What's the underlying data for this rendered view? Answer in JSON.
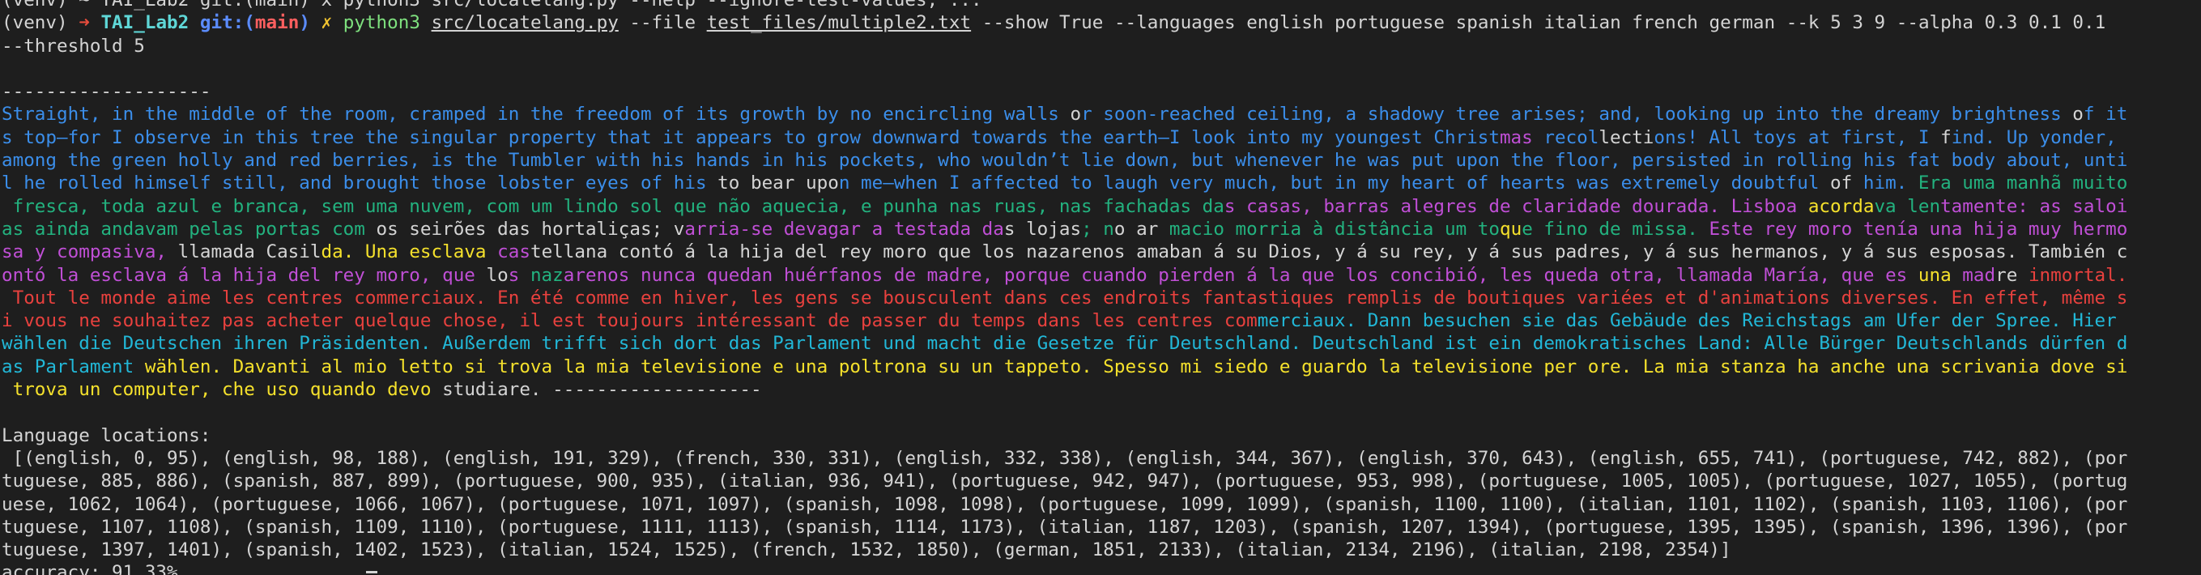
{
  "terminal": {
    "top_partial": "(venv) ~ TAI_Lab2 git:(main) x python3 src/locatelang.py --help --ignore-test-values; ...",
    "prompt": {
      "venv": "(venv) ",
      "arrow": "➜",
      "dir": "TAI_Lab2",
      "git_label": "git:(",
      "branch": "main",
      "git_close": ")",
      "mark": "✗",
      "cmd_program": "python3 ",
      "cmd_script": "src/locatelang.py",
      "cmd_file_flag": " --file ",
      "cmd_file": "test_files/multiple2.txt",
      "cmd_rest": " --show True --languages english portuguese spanish italian french german --k 5 3 9 --alpha 0.3 0.1 0.1",
      "cmd_line2": "--threshold 5"
    },
    "separator": "-------------------",
    "colored_lines": [
      [
        [
          "english",
          "Straight, in the middle of the room, cramped in the freedom of its growth by no encircling walls "
        ],
        [
          "plain",
          "o"
        ],
        [
          "english",
          "r soon-reached ceiling, a shadowy tree arises; and, looking up into the dreamy brightness "
        ],
        [
          "plain",
          "o"
        ],
        [
          "english",
          "f it"
        ]
      ],
      [
        [
          "english",
          "s top—for I observe in this tree the singular property that it appears to grow downward towards the earth—I look into my youngest Christ"
        ],
        [
          "spanish",
          "mas"
        ],
        [
          "english",
          " recol"
        ],
        [
          "plain",
          "lecti"
        ],
        [
          "english",
          "ons! All toys at first, I "
        ],
        [
          "plain",
          "f"
        ],
        [
          "english",
          "ind. Up yonder,"
        ]
      ],
      [
        [
          "english",
          "among the green holly and red berries, is the Tumbler with his hands in his pockets, who wouldn’t lie down, but whenever he was put upon the floor, persisted in rolling his fat body about, unti"
        ]
      ],
      [
        [
          "english",
          "l he rolled himself still, and brought those lobster eyes of his "
        ],
        [
          "plain",
          "to bear upo"
        ],
        [
          "english",
          "n me—when I affected to laugh very much, but in my heart of hearts was extremely doubtful "
        ],
        [
          "plain",
          "of"
        ],
        [
          "english",
          " him. "
        ],
        [
          "portuguese",
          "Era uma manhã muito"
        ]
      ],
      [
        [
          "portuguese",
          " fresca, toda azul e branca, sem uma nuvem, com um lindo sol que não aquecia, e punha nas ruas, nas fachadas da"
        ],
        [
          "spanish",
          "s casas, barras alegres de claridade dourada. Lisboa "
        ],
        [
          "italian",
          "acorda"
        ],
        [
          "portuguese",
          "va len"
        ],
        [
          "spanish",
          "tamente: as saloi"
        ]
      ],
      [
        [
          "portuguese",
          "as ainda andavam pelas portas com "
        ],
        [
          "plain",
          "os seirões das hortaliças; v"
        ],
        [
          "spanish",
          "arria-se devagar a testada da"
        ],
        [
          "plain",
          "s lojas"
        ],
        [
          "portuguese",
          "; n"
        ],
        [
          "plain",
          "o ar "
        ],
        [
          "portuguese",
          "macio morria à distância um to"
        ],
        [
          "italian",
          "qu"
        ],
        [
          "portuguese",
          "e fino de missa. "
        ],
        [
          "spanish",
          "Este rey moro tenía una hija muy hermo"
        ]
      ],
      [
        [
          "spanish",
          "sa y compasiva, "
        ],
        [
          "plain",
          "llamada Casil"
        ],
        [
          "italian",
          "da. Una esclava "
        ],
        [
          "spanish",
          "cas"
        ],
        [
          "plain",
          "tellana contó á la hija del rey moro que los nazarenos amaban á su Dios, y á su rey, y á sus padres, y á sus hermanos, y á sus esposas. También c"
        ]
      ],
      [
        [
          "spanish",
          "ontó la esclava á la hija del rey moro, que "
        ],
        [
          "plain",
          "lo"
        ],
        [
          "spanish",
          "s "
        ],
        [
          "portuguese",
          "naz"
        ],
        [
          "spanish",
          "arenos nunca quedan huérfanos de madre, porque cuando pierden á la que los concibió, les queda otra, llamada María, que es "
        ],
        [
          "italian",
          "una"
        ],
        [
          "spanish",
          " mad"
        ],
        [
          "plain",
          "re "
        ],
        [
          "french",
          "inmortal."
        ]
      ],
      [
        [
          "french",
          " Tout le monde aime les centres commerciaux. En été comme en hiver, les gens se bousculent dans ces endroits fantastiques remplis de boutiques variées et d'animations diverses. En effet, même s"
        ]
      ],
      [
        [
          "french",
          "i vous ne souhaitez pas acheter quelque chose, il est toujours intéressant de passer du temps dans les centres com"
        ],
        [
          "german",
          "merciaux. Dann besuchen sie das Gebäude des Reichstags am Ufer der Spree. Hier"
        ]
      ],
      [
        [
          "german",
          "wählen die Deutschen ihren Präsidenten. Außerdem trifft sich dort das Parlament und macht die Gesetze für Deutschland. Deutschland ist ein demokratisches Land: Alle Bürger Deutschlands dürfen d"
        ]
      ],
      [
        [
          "german",
          "as Parlament "
        ],
        [
          "italian",
          "wählen. Davanti al mio letto si trova la mia televisione e una poltrona su un tappeto. Spesso mi siedo e guardo la televisione per ore. La mia stanza ha anche una scrivania dove si"
        ]
      ],
      [
        [
          "italian",
          " trova un computer, che uso quando devo "
        ],
        [
          "plain",
          "studiare. -------------------"
        ]
      ]
    ],
    "locations_label": "Language locations:",
    "locations_lines": [
      " [(english, 0, 95), (english, 98, 188), (english, 191, 329), (french, 330, 331), (english, 332, 338), (english, 344, 367), (english, 370, 643), (english, 655, 741), (portuguese, 742, 882), (por",
      "tuguese, 885, 886), (spanish, 887, 899), (portuguese, 900, 935), (italian, 936, 941), (portuguese, 942, 947), (portuguese, 953, 998), (portuguese, 1005, 1005), (portuguese, 1027, 1055), (portug",
      "uese, 1062, 1064), (portuguese, 1066, 1067), (portuguese, 1071, 1097), (spanish, 1098, 1098), (portuguese, 1099, 1099), (spanish, 1100, 1100), (italian, 1101, 1102), (spanish, 1103, 1106), (por",
      "tuguese, 1107, 1108), (spanish, 1109, 1110), (portuguese, 1111, 1113), (spanish, 1114, 1173), (italian, 1187, 1203), (spanish, 1207, 1394), (portuguese, 1395, 1395), (spanish, 1396, 1396), (por",
      "tuguese, 1397, 1401), (spanish, 1402, 1523), (italian, 1524, 1525), (french, 1532, 1850), (german, 1851, 2133), (italian, 2134, 2196), (italian, 2198, 2354)]"
    ],
    "accuracy": "accuracy: 91.33%",
    "language_colors": {
      "english": "#3b8eea",
      "portuguese": "#23b27f",
      "spanish": "#c04fd6",
      "italian": "#f5e12c",
      "french": "#e8413e",
      "german": "#22b8d8",
      "plain": "#d4d4d4"
    }
  }
}
